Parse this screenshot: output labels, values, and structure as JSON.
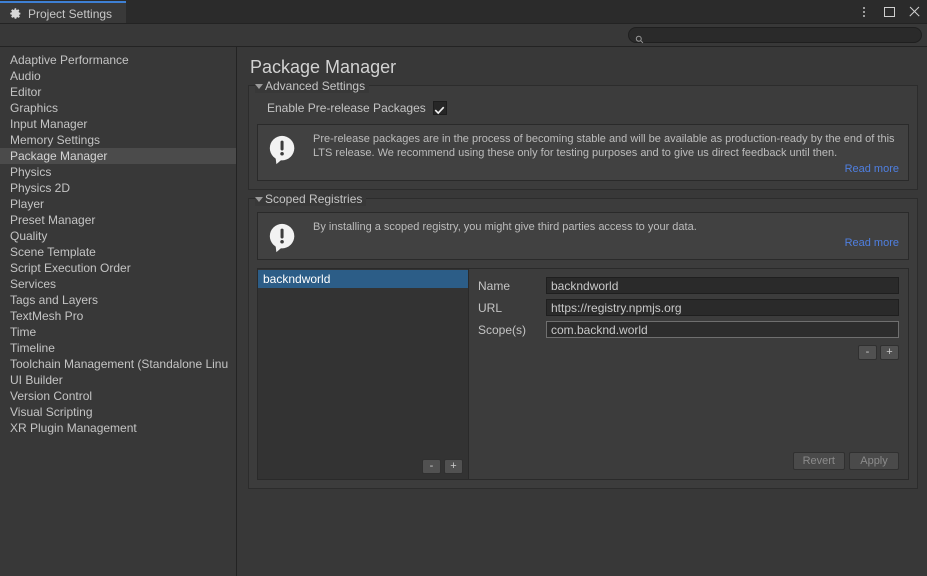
{
  "window": {
    "tab_label": "Project Settings",
    "tab_icon": "gear-icon",
    "controls": [
      {
        "name": "more-options-icon",
        "glyph": "vertical-dots"
      },
      {
        "name": "maximize-icon",
        "glyph": "square"
      },
      {
        "name": "close-icon",
        "glyph": "x"
      }
    ]
  },
  "search": {
    "value": "",
    "placeholder": "",
    "icon": "search-icon"
  },
  "sidebar": {
    "items": [
      {
        "label": "Adaptive Performance",
        "selected": false
      },
      {
        "label": "Audio",
        "selected": false
      },
      {
        "label": "Editor",
        "selected": false
      },
      {
        "label": "Graphics",
        "selected": false
      },
      {
        "label": "Input Manager",
        "selected": false
      },
      {
        "label": "Memory Settings",
        "selected": false
      },
      {
        "label": "Package Manager",
        "selected": true
      },
      {
        "label": "Physics",
        "selected": false
      },
      {
        "label": "Physics 2D",
        "selected": false
      },
      {
        "label": "Player",
        "selected": false
      },
      {
        "label": "Preset Manager",
        "selected": false
      },
      {
        "label": "Quality",
        "selected": false
      },
      {
        "label": "Scene Template",
        "selected": false
      },
      {
        "label": "Script Execution Order",
        "selected": false
      },
      {
        "label": "Services",
        "selected": false
      },
      {
        "label": "Tags and Layers",
        "selected": false
      },
      {
        "label": "TextMesh Pro",
        "selected": false
      },
      {
        "label": "Time",
        "selected": false
      },
      {
        "label": "Timeline",
        "selected": false
      },
      {
        "label": "Toolchain Management (Standalone Linu",
        "selected": false
      },
      {
        "label": "UI Builder",
        "selected": false
      },
      {
        "label": "Version Control",
        "selected": false
      },
      {
        "label": "Visual Scripting",
        "selected": false
      },
      {
        "label": "XR Plugin Management",
        "selected": false
      }
    ]
  },
  "main": {
    "page_title": "Package Manager",
    "advanced": {
      "title": "Advanced Settings",
      "prerelease_label": "Enable Pre-release Packages",
      "prerelease_checked": true,
      "help_text": "Pre-release packages are in the process of becoming stable and will be available as production-ready by the end of this LTS release. We recommend using these only for testing purposes and to give us direct feedback until then.",
      "read_more": "Read more"
    },
    "scoped": {
      "title": "Scoped Registries",
      "help_text": "By installing a scoped registry, you might give third parties access to your data.",
      "read_more": "Read more",
      "registries": [
        {
          "name": "backndworld",
          "selected": true
        }
      ],
      "list_buttons": {
        "remove": "-",
        "add": "+"
      },
      "form": {
        "name_label": "Name",
        "name_value": "backndworld",
        "url_label": "URL",
        "url_value": "https://registry.npmjs.org",
        "scopes_label": "Scope(s)",
        "scopes_value": "com.backnd.world",
        "scope_buttons": {
          "remove": "-",
          "add": "+"
        },
        "revert_label": "Revert",
        "apply_label": "Apply"
      }
    }
  },
  "colors": {
    "accent_tab": "#3e80d4",
    "selection": "#2c5d87",
    "link": "#4f7fe0",
    "background": "#383838"
  }
}
